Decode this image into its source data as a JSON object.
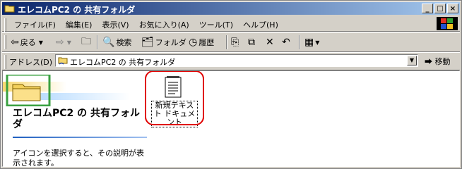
{
  "window": {
    "title": "エレコムPC2 の 共有フォルダ",
    "buttons": [
      "_",
      "□",
      "×"
    ]
  },
  "menu": {
    "items": [
      "ファイル(F)",
      "編集(E)",
      "表示(V)",
      "お気に入り(A)",
      "ツール(T)",
      "ヘルプ(H)"
    ]
  },
  "toolbar": {
    "back": "戻る",
    "search": "検索",
    "folders": "フォルダ",
    "history": "履歴"
  },
  "address": {
    "label": "アドレス(D)",
    "value": "エレコムPC2 の 共有フォルダ",
    "go": "移動"
  },
  "webview": {
    "title": "エレコムPC2 の 共有フォルダ",
    "description": "アイコンを選択すると、その説明が表示されます。"
  },
  "files": [
    {
      "name": "新規テキスト ドキュメント",
      "icon": "text-document-icon"
    }
  ],
  "colors": {
    "titlebar_start": "#0a246a",
    "titlebar_end": "#a6caf0",
    "highlight": "#e00000"
  }
}
